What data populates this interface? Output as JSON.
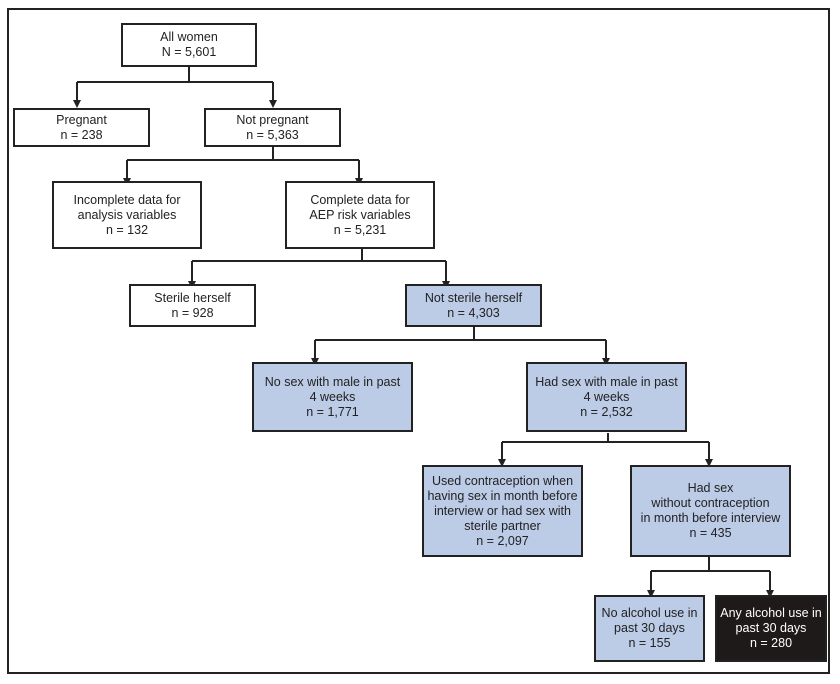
{
  "colors": {
    "highlight": "#bccbe6",
    "emphasis": "#1e1a1a",
    "border": "#222222"
  },
  "nodes": {
    "all_women": {
      "lines": [
        "All women",
        "N = 5,601"
      ]
    },
    "pregnant": {
      "lines": [
        "Pregnant",
        "n = 238"
      ]
    },
    "not_pregnant": {
      "lines": [
        "Not pregnant",
        "n = 5,363"
      ]
    },
    "incomplete": {
      "lines": [
        "Incomplete data for",
        "analysis variables",
        "n = 132"
      ]
    },
    "complete": {
      "lines": [
        "Complete data for",
        "AEP risk variables",
        "n = 5,231"
      ]
    },
    "sterile": {
      "lines": [
        "Sterile herself",
        "n = 928"
      ]
    },
    "not_sterile": {
      "lines": [
        "Not sterile herself",
        "n = 4,303"
      ]
    },
    "no_sex": {
      "lines": [
        "No sex with male in past",
        "4 weeks",
        "n = 1,771"
      ]
    },
    "had_sex": {
      "lines": [
        "Had sex with male in past",
        "4 weeks",
        "n = 2,532"
      ]
    },
    "contraception": {
      "lines": [
        "Used contraception when",
        "having sex in month before",
        "interview or had sex with",
        "sterile partner",
        "n = 2,097"
      ]
    },
    "no_contraception": {
      "lines": [
        "Had sex",
        "without contraception",
        "in month before interview",
        "n = 435"
      ]
    },
    "no_alcohol": {
      "lines": [
        "No alcohol use in",
        "past 30 days",
        "n = 155"
      ]
    },
    "any_alcohol": {
      "lines": [
        "Any alcohol use in",
        "past 30 days",
        "n = 280"
      ]
    }
  }
}
